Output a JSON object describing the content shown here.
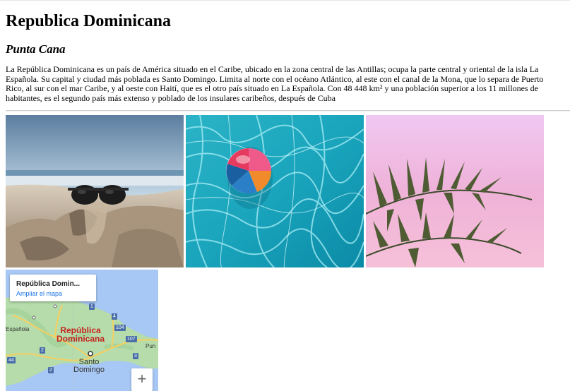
{
  "page": {
    "title": "Republica Dominicana",
    "subtitle": "Punta Cana",
    "description": "La República Dominicana es un país de América situado en el Caribe, ubicado en la zona central de las Antillas; ocupa la parte central y oriental de la isla La Española. Su capital y ciudad más poblada es Santo Domingo. Limita al norte con el océano Atlántico, al este con el canal de la Mona, que lo separa de Puerto Rico, al sur con el mar Caribe, y al oeste con Haití, que es el otro país situado en La Española. Con 48 448 km² y una población superior a los 11 millones de habitantes, es el segundo país más extenso y poblado de los insulares caribeños, después de Cuba"
  },
  "gallery": [
    {
      "name": "beach-sunglasses"
    },
    {
      "name": "pool-beach-ball"
    },
    {
      "name": "palm-leaves"
    }
  ],
  "map": {
    "place_name": "República Domin...",
    "enlarge_link": "Ampliar el mapa",
    "country_label_line1": "República",
    "country_label_line2": "Dominicana",
    "capital_line1": "Santo",
    "capital_line2": "Domingo",
    "left_label": "Española",
    "right_label": "Pun",
    "zoom_in": "+",
    "road_shields": [
      "1",
      "2",
      "104",
      "107",
      "3",
      "4",
      "44",
      "2"
    ],
    "colors": {
      "sea": "#a7c7f4",
      "land": "#b5dcaa",
      "road": "#f6cf63",
      "country_label": "#c5221f"
    }
  }
}
